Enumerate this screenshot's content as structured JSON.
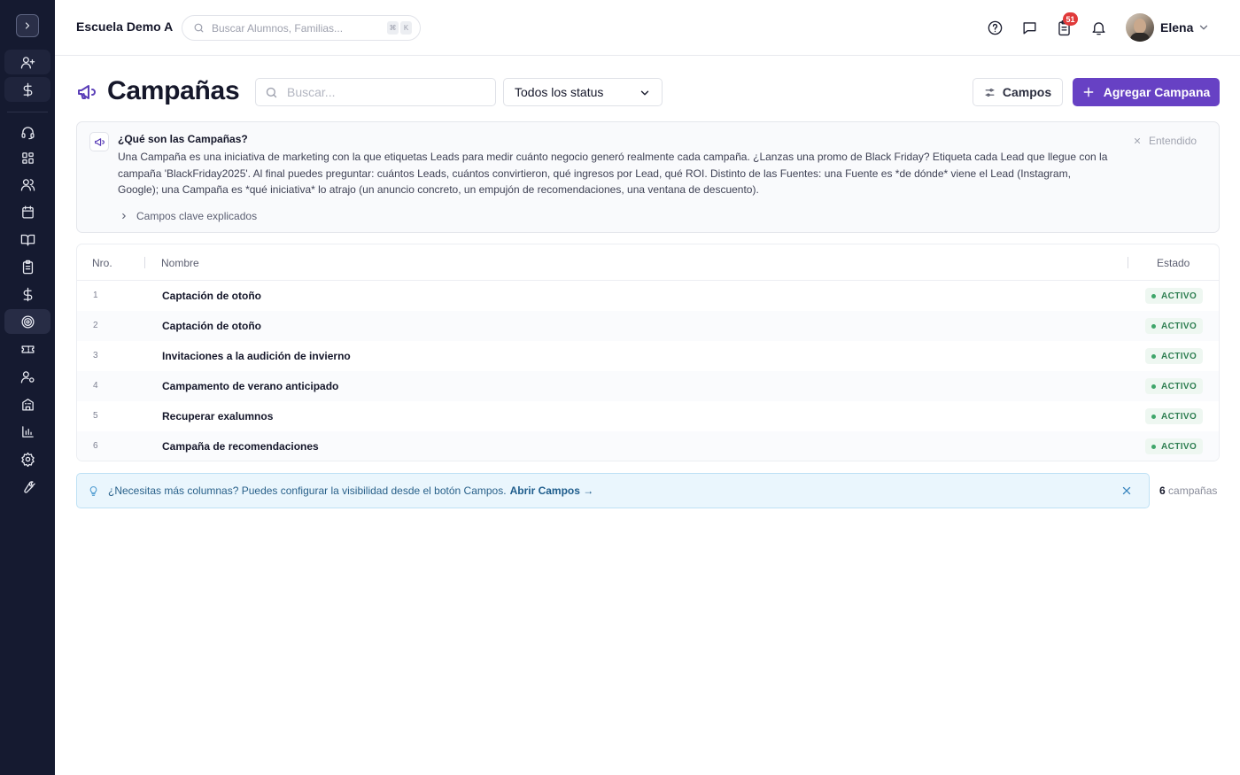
{
  "topbar": {
    "school_name": "Escuela Demo A",
    "search_placeholder": "Buscar Alumnos, Familias...",
    "kbd_cmd": "⌘",
    "kbd_key": "K",
    "tasks_badge": "51",
    "user_name": "Elena"
  },
  "sidebar": {
    "items": [
      {
        "icon": "user-plus-icon"
      },
      {
        "icon": "dollar-icon"
      },
      {
        "icon": "headset-icon"
      },
      {
        "icon": "grid-icon"
      },
      {
        "icon": "users-icon"
      },
      {
        "icon": "calendar-icon"
      },
      {
        "icon": "book-open-icon"
      },
      {
        "icon": "clipboard-icon"
      },
      {
        "icon": "dollar-icon"
      },
      {
        "icon": "target-icon",
        "active": true
      },
      {
        "icon": "ticket-icon"
      },
      {
        "icon": "user-settings-icon"
      },
      {
        "icon": "building-icon"
      },
      {
        "icon": "bar-chart-icon"
      },
      {
        "icon": "gear-icon"
      },
      {
        "icon": "wrench-icon"
      }
    ]
  },
  "page": {
    "title": "Campañas",
    "search_placeholder": "Buscar...",
    "status_filter": "Todos los status",
    "campos_label": "Campos",
    "add_label": "Agregar Campana"
  },
  "info": {
    "title": "¿Qué son las Campañas?",
    "body": "Una Campaña es una iniciativa de marketing con la que etiquetas Leads para medir cuánto negocio generó realmente cada campaña. ¿Lanzas una promo de Black Friday? Etiqueta cada Lead que llegue con la campaña 'BlackFriday2025'. Al final puedes preguntar: cuántos Leads, cuántos convirtieron, qué ingresos por Lead, qué ROI. Distinto de las Fuentes: una Fuente es *de dónde* viene el Lead (Instagram, Google); una Campaña es *qué iniciativa* lo atrajo (un anuncio concreto, un empujón de recomendaciones, una ventana de descuento).",
    "dismiss_label": "Entendido",
    "expand_label": "Campos clave explicados"
  },
  "table": {
    "headers": {
      "num": "Nro.",
      "name": "Nombre",
      "status": "Estado"
    },
    "rows": [
      {
        "num": "1",
        "name": "Captación de otoño",
        "status": "ACTIVO"
      },
      {
        "num": "2",
        "name": "Captación de otoño",
        "status": "ACTIVO"
      },
      {
        "num": "3",
        "name": "Invitaciones a la audición de invierno",
        "status": "ACTIVO"
      },
      {
        "num": "4",
        "name": "Campamento de verano anticipado",
        "status": "ACTIVO"
      },
      {
        "num": "5",
        "name": "Recuperar exalumnos",
        "status": "ACTIVO"
      },
      {
        "num": "6",
        "name": "Campaña de recomendaciones",
        "status": "ACTIVO"
      }
    ]
  },
  "hint": {
    "text": "¿Necesitas más columnas? Puedes configurar la visibilidad desde el botón Campos.",
    "link": "Abrir Campos →"
  },
  "footer": {
    "count": "6",
    "count_label": "campañas"
  },
  "colors": {
    "sidebar_bg": "#151a30",
    "accent": "#6741c4",
    "status_active": "#2f7f52",
    "hint_bg": "#eaf6fd"
  }
}
